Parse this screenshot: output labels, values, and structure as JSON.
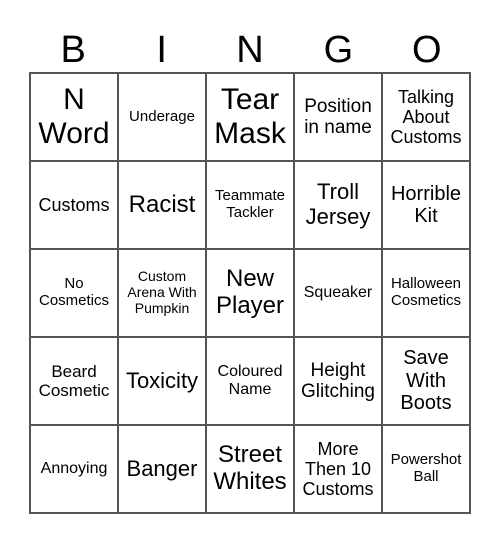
{
  "header": [
    "B",
    "I",
    "N",
    "G",
    "O"
  ],
  "cells": [
    [
      "N Word",
      "Underage",
      "Tear Mask",
      "Position in name",
      "Talking About Customs"
    ],
    [
      "Customs",
      "Racist",
      "Teammate Tackler",
      "Troll Jersey",
      "Horrible Kit"
    ],
    [
      "No Cosmetics",
      "Custom Arena With Pumpkin",
      "New Player",
      "Squeaker",
      "Halloween Cosmetics"
    ],
    [
      "Beard Cosmetic",
      "Toxicity",
      "Coloured Name",
      "Height Glitching",
      "Save With Boots"
    ],
    [
      "Annoying",
      "Banger",
      "Street Whites",
      "More Then 10 Customs",
      "Powershot Ball"
    ]
  ]
}
